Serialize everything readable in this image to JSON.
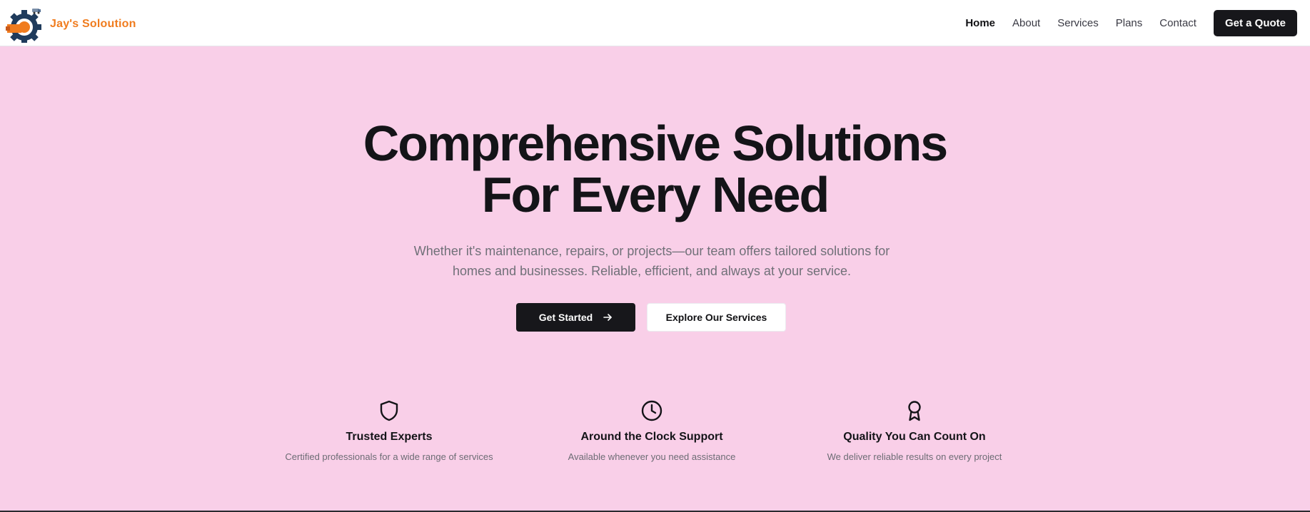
{
  "header": {
    "brand": "Jay's Soloution",
    "nav": [
      {
        "label": "Home",
        "active": true
      },
      {
        "label": "About",
        "active": false
      },
      {
        "label": "Services",
        "active": false
      },
      {
        "label": "Plans",
        "active": false
      },
      {
        "label": "Contact",
        "active": false
      }
    ],
    "cta_label": "Get a Quote"
  },
  "hero": {
    "title_line1": "Comprehensive Solutions",
    "title_line2": "For Every Need",
    "subtitle": "Whether it's maintenance, repairs, or projects—our team offers tailored solutions for homes and businesses. Reliable, efficient, and always at your service.",
    "primary_button": "Get Started",
    "secondary_button": "Explore Our Services",
    "background_color": "#f9cfe8"
  },
  "features": [
    {
      "icon": "shield-icon",
      "title": "Trusted Experts",
      "description": "Certified professionals for a wide range of services"
    },
    {
      "icon": "clock-icon",
      "title": "Around the Clock Support",
      "description": "Available whenever you need assistance"
    },
    {
      "icon": "award-icon",
      "title": "Quality You Can Count On",
      "description": "We deliver reliable results on every project"
    }
  ],
  "colors": {
    "brand": "#f07c1e",
    "dark": "#17171b"
  }
}
